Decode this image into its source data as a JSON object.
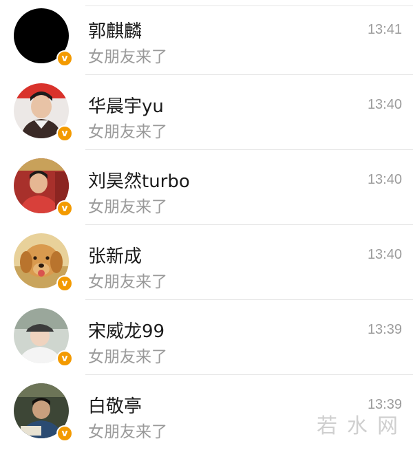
{
  "conversations": [
    {
      "name": "郭麒麟",
      "preview": "女朋友来了",
      "time": "13:41",
      "verified": "v",
      "avatar": "black-avatar"
    },
    {
      "name": "华晨宇yu",
      "preview": "女朋友来了",
      "time": "13:40",
      "verified": "v",
      "avatar": "child-portrait-avatar"
    },
    {
      "name": "刘昊然turbo",
      "preview": "女朋友来了",
      "time": "13:40",
      "verified": "v",
      "avatar": "child-red-background-avatar"
    },
    {
      "name": "张新成",
      "preview": "女朋友来了",
      "time": "13:40",
      "verified": "v",
      "avatar": "golden-dog-avatar"
    },
    {
      "name": "宋威龙99",
      "preview": "女朋友来了",
      "time": "13:39",
      "verified": "v",
      "avatar": "child-hat-avatar"
    },
    {
      "name": "白敬亭",
      "preview": "女朋友来了",
      "time": "13:39",
      "verified": "v",
      "avatar": "child-studying-avatar"
    }
  ],
  "watermark": "若水网",
  "colors": {
    "badge": "#f39a00",
    "name": "#1b1b1b",
    "preview": "#9a9a9a",
    "time": "#9c9c9c",
    "divider": "#e6e6e6"
  }
}
